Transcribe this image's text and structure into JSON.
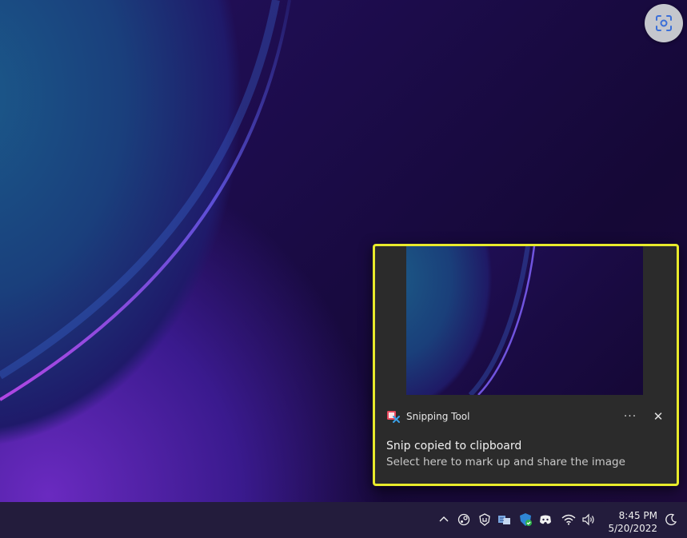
{
  "notification": {
    "app_name": "Snipping Tool",
    "title": "Snip copied to clipboard",
    "body": "Select here to mark up and share the image",
    "more_label": "···",
    "close_label": "✕"
  },
  "taskbar": {
    "time": "8:45 PM",
    "date": "5/20/2022",
    "tray_icons": [
      "chevron-up-icon",
      "steam-icon",
      "shield-security-icon",
      "network-adapter-icon",
      "windows-security-icon",
      "discord-icon",
      "wifi-icon",
      "volume-icon"
    ],
    "focus_icon": "moon-icon"
  },
  "colors": {
    "highlight_border": "#e8ea2b",
    "toast_bg": "#2b2b2b",
    "taskbar_bg": "#231c3c"
  }
}
